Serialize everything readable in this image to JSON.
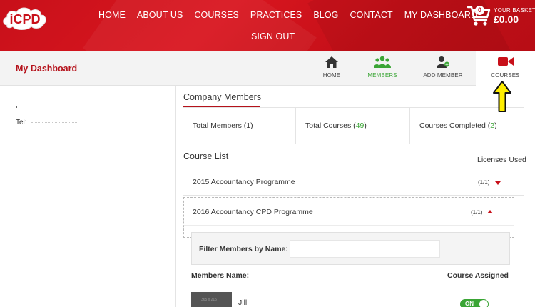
{
  "header": {
    "logo_text": "iCPD",
    "nav_row1": [
      "HOME",
      "ABOUT US",
      "COURSES",
      "PRACTICES",
      "BLOG",
      "CONTACT",
      "MY DASHBOARD"
    ],
    "nav_row2": [
      "SIGN OUT"
    ],
    "basket": {
      "count": "0",
      "label": "YOUR BASKET",
      "total": "£0.00"
    }
  },
  "dashboard_bar": {
    "title": "My Dashboard",
    "items": [
      {
        "label": "HOME",
        "icon": "home-icon"
      },
      {
        "label": "MEMBERS",
        "icon": "members-icon",
        "active": true
      },
      {
        "label": "ADD MEMBER",
        "icon": "add-member-icon"
      },
      {
        "label": "COURSES",
        "icon": "video-camera-icon",
        "selected": true
      }
    ]
  },
  "left_panel": {
    "tel_label": "Tel:"
  },
  "company_members": {
    "title": "Company Members",
    "stats": [
      {
        "label": "Total Members",
        "value": "1"
      },
      {
        "label": "Total Courses",
        "value": "49"
      },
      {
        "label": "Courses Completed",
        "value": "2"
      }
    ]
  },
  "course_list": {
    "title": "Course List",
    "licenses_header": "Licenses Used",
    "courses": [
      {
        "name": "2015 Accountancy Programme",
        "licenses": "(1/1)",
        "expanded": false
      },
      {
        "name": "2016 Accountancy CPD Programme",
        "licenses": "(1/1)",
        "expanded": true
      }
    ]
  },
  "filter": {
    "label": "Filter Members by Name:",
    "value": "",
    "placeholder": ""
  },
  "members_table": {
    "col_name": "Members Name:",
    "col_assigned": "Course Assigned",
    "rows": [
      {
        "name": "Jill",
        "thumb_text": "365 x 215",
        "assigned": "ON"
      }
    ]
  },
  "colors": {
    "brand_red": "#c8101a",
    "accent_green": "#3aa535",
    "arrow_yellow": "#ffee00"
  }
}
